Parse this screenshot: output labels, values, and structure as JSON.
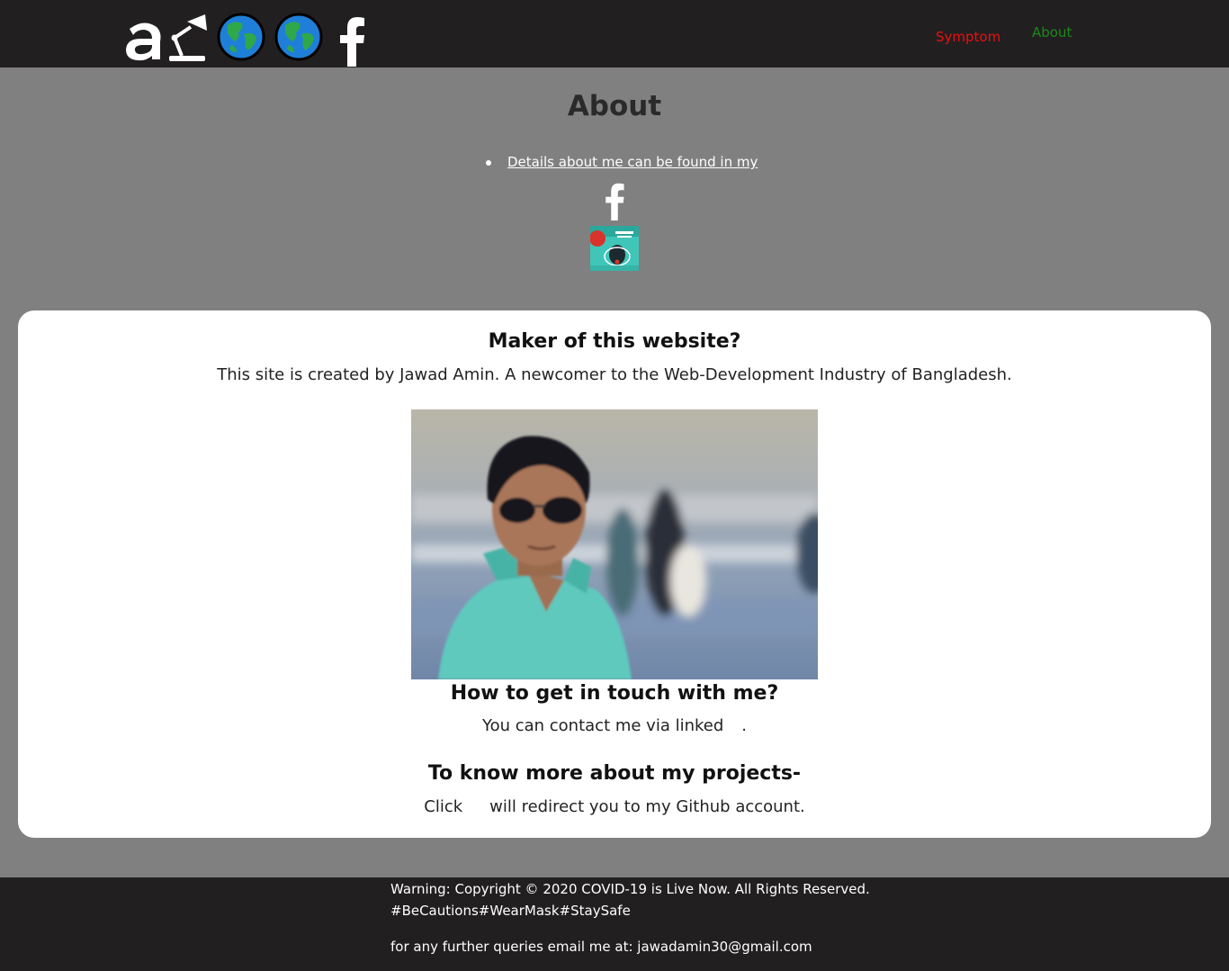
{
  "header": {
    "nav": {
      "symptom_label": "Symptom",
      "about_label": "About"
    },
    "colors": {
      "background": "#221f20",
      "symptom": "#e81010",
      "about": "#1a8a1a"
    }
  },
  "about": {
    "title": "About",
    "detail_link": "Details about me can be found in my"
  },
  "card": {
    "maker_heading": "Maker of this website?",
    "maker_text": "This site is created by Jawad Amin. A newcomer to the Web-Development Industry of Bangladesh.",
    "touch_heading": "How to get in touch with me?",
    "touch_text_before": "You can contact me via linked",
    "touch_text_after": ".",
    "projects_heading": "To know more about my projects-",
    "projects_text_before": "Click",
    "projects_text_after": "will redirect you to my Github account."
  },
  "footer": {
    "copyright": "Warning: Copyright © 2020 COVID-19 is Live Now. All Rights Reserved.",
    "hashtags": "#BeCautions#WearMask#StaySafe",
    "email_line": "for any further queries email me at: jawadamin30@gmail.com"
  },
  "icons": [
    "site-logo-icon",
    "globe-icon",
    "facebook-icon",
    "profile-thumbnail"
  ]
}
